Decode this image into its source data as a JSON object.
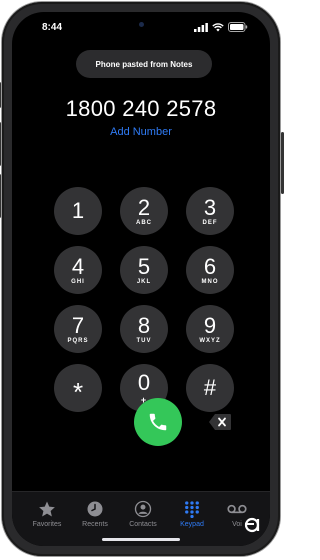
{
  "status_bar": {
    "time": "8:44"
  },
  "toast": {
    "text": "Phone pasted from Notes"
  },
  "dialer": {
    "number": "1800 240 2578",
    "add_number_label": "Add Number"
  },
  "keypad": {
    "keys": [
      {
        "digit": "1",
        "letters": ""
      },
      {
        "digit": "2",
        "letters": "ABC"
      },
      {
        "digit": "3",
        "letters": "DEF"
      },
      {
        "digit": "4",
        "letters": "GHI"
      },
      {
        "digit": "5",
        "letters": "JKL"
      },
      {
        "digit": "6",
        "letters": "MNO"
      },
      {
        "digit": "7",
        "letters": "PQRS"
      },
      {
        "digit": "8",
        "letters": "TUV"
      },
      {
        "digit": "9",
        "letters": "WXYZ"
      },
      {
        "digit": "*",
        "letters": ""
      },
      {
        "digit": "0",
        "letters": "+"
      },
      {
        "digit": "#",
        "letters": ""
      }
    ]
  },
  "tabs": [
    {
      "label": "Favorites",
      "icon": "star-icon"
    },
    {
      "label": "Recents",
      "icon": "clock-icon"
    },
    {
      "label": "Contacts",
      "icon": "person-icon"
    },
    {
      "label": "Keypad",
      "icon": "keypad-icon",
      "active": true
    },
    {
      "label": "Voi",
      "icon": "voicemail-icon"
    }
  ],
  "colors": {
    "accent": "#2f7bf5",
    "call": "#34c759",
    "key_bg": "#333335"
  }
}
